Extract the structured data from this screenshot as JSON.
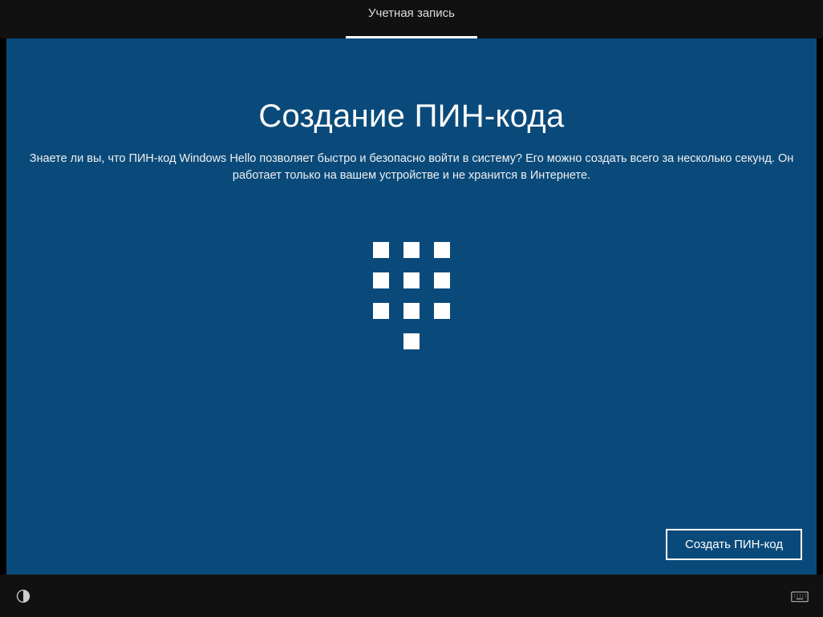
{
  "header": {
    "tab_label": "Учетная запись"
  },
  "main": {
    "title": "Создание ПИН-кода",
    "subtitle": "Знаете ли вы, что ПИН-код Windows Hello позволяет быстро и безопасно войти в систему? Его можно создать всего за несколько секунд. Он работает только на вашем устройстве и не хранится в Интернете."
  },
  "actions": {
    "create_pin_label": "Создать ПИН-код"
  },
  "colors": {
    "background_blue": "#0a4a7a",
    "bar_dark": "#111111",
    "accent_white": "#ffffff"
  }
}
